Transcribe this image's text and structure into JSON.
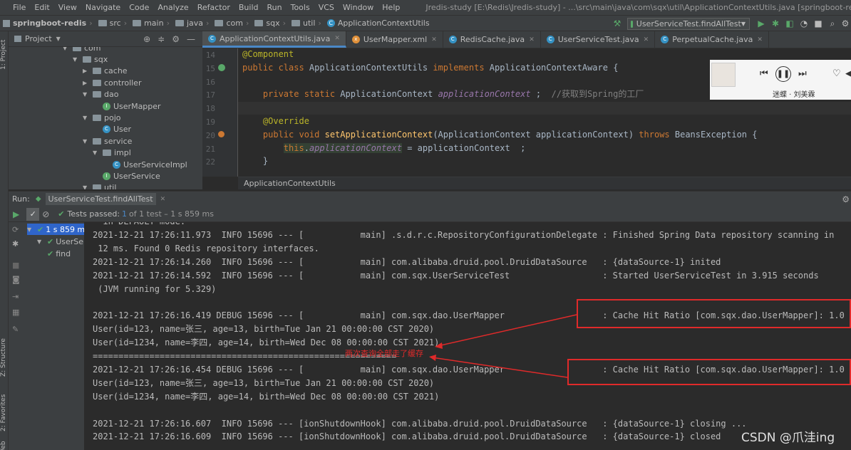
{
  "menu": {
    "items": [
      "File",
      "Edit",
      "View",
      "Navigate",
      "Code",
      "Analyze",
      "Refactor",
      "Build",
      "Run",
      "Tools",
      "VCS",
      "Window",
      "Help"
    ],
    "window_title": "Jredis-study [E:\\Redis\\Jredis-study] - ...\\src\\main\\java\\com\\sqx\\util\\ApplicationContextUtils.java [springboot-redis]"
  },
  "nav": {
    "crumbs": [
      "springboot-redis",
      "src",
      "main",
      "java",
      "com",
      "sqx",
      "util",
      "ApplicationContextUtils"
    ],
    "run_config": "UserServiceTest.findAllTest"
  },
  "stripe": {
    "project": "1: Project",
    "structure": "Z: Structure",
    "favorites": "2: Favorites",
    "web": "Web"
  },
  "project": {
    "title": "Project",
    "tree": [
      {
        "label": "com",
        "depth": 0,
        "kind": "folder",
        "open": true
      },
      {
        "label": "sqx",
        "depth": 1,
        "kind": "folder",
        "open": true
      },
      {
        "label": "cache",
        "depth": 2,
        "kind": "folder",
        "open": false
      },
      {
        "label": "controller",
        "depth": 2,
        "kind": "folder",
        "open": false
      },
      {
        "label": "dao",
        "depth": 2,
        "kind": "folder",
        "open": true
      },
      {
        "label": "UserMapper",
        "depth": 3,
        "kind": "interface"
      },
      {
        "label": "pojo",
        "depth": 2,
        "kind": "folder",
        "open": true
      },
      {
        "label": "User",
        "depth": 3,
        "kind": "class"
      },
      {
        "label": "service",
        "depth": 2,
        "kind": "folder",
        "open": true
      },
      {
        "label": "impl",
        "depth": 3,
        "kind": "folder",
        "open": true
      },
      {
        "label": "UserServiceImpl",
        "depth": 4,
        "kind": "class"
      },
      {
        "label": "UserService",
        "depth": 3,
        "kind": "interface"
      },
      {
        "label": "util",
        "depth": 2,
        "kind": "folder",
        "open": true
      }
    ]
  },
  "editor": {
    "tabs": [
      {
        "label": "ApplicationContextUtils.java",
        "active": true,
        "icon": "class-icon",
        "color": "#3592c4"
      },
      {
        "label": "UserMapper.xml",
        "active": false,
        "icon": "xml-icon",
        "color": "#e0913b"
      },
      {
        "label": "RedisCache.java",
        "active": false,
        "icon": "class-icon",
        "color": "#3592c4"
      },
      {
        "label": "UserServiceTest.java",
        "active": false,
        "icon": "test-class-icon",
        "color": "#3592c4"
      },
      {
        "label": "PerpetualCache.java",
        "active": false,
        "icon": "class-icon",
        "color": "#3592c4"
      }
    ],
    "line_numbers": [
      "14",
      "15",
      "16",
      "17",
      "18",
      "19",
      "20",
      "21",
      "22"
    ],
    "lines": [
      [
        {
          "t": "@Component",
          "c": "ann"
        }
      ],
      [
        {
          "t": "public class ",
          "c": "kw"
        },
        {
          "t": "ApplicationContextUtils ",
          "c": ""
        },
        {
          "t": "implements ",
          "c": "kw"
        },
        {
          "t": "ApplicationContextAware {",
          "c": ""
        }
      ],
      [],
      [
        {
          "t": "    private static ",
          "c": "kw"
        },
        {
          "t": "ApplicationContext ",
          "c": ""
        },
        {
          "t": "applicationContext",
          "c": "fld"
        },
        {
          "t": " ;  ",
          "c": ""
        },
        {
          "t": "//获取到Spring的工厂",
          "c": "cm"
        }
      ],
      [],
      [
        {
          "t": "    @Override",
          "c": "ann"
        }
      ],
      [
        {
          "t": "    public void ",
          "c": "kw"
        },
        {
          "t": "setApplicationContext",
          "c": "fn"
        },
        {
          "t": "(ApplicationContext applicationContext) ",
          "c": ""
        },
        {
          "t": "throws ",
          "c": "kw"
        },
        {
          "t": "BeansException {",
          "c": ""
        }
      ],
      [
        {
          "t": "        ",
          "c": ""
        },
        {
          "t": "this",
          "c": "kw"
        },
        {
          "t": ".",
          "c": ""
        },
        {
          "t": "applicationContext",
          "c": "fld"
        },
        {
          "t": " = applicationContext  ;",
          "c": ""
        }
      ],
      [
        {
          "t": "    }",
          "c": ""
        }
      ]
    ],
    "breadcrumb": "ApplicationContextUtils"
  },
  "music": {
    "song": "迷蝶 · 刘美霖"
  },
  "run": {
    "label": "Run:",
    "config": "UserServiceTest.findAllTest",
    "status_prefix": "Tests passed:",
    "status_count": "1",
    "status_rest": "of 1 test – 1 s 859 ms",
    "tree": [
      {
        "label": "1 s 859 ms",
        "depth": 0
      },
      {
        "label": "UserSe",
        "depth": 1
      },
      {
        "label": "find",
        "depth": 2
      }
    ],
    "console_lines": [
      "  in DEFAULT mode.",
      "2021-12-21 17:26:11.973  INFO 15696 --- [           main] .s.d.r.c.RepositoryConfigurationDelegate : Finished Spring Data repository scanning in",
      " 12 ms. Found 0 Redis repository interfaces.",
      "2021-12-21 17:26:14.260  INFO 15696 --- [           main] com.alibaba.druid.pool.DruidDataSource   : {dataSource-1} inited",
      "2021-12-21 17:26:14.592  INFO 15696 --- [           main] com.sqx.UserServiceTest                  : Started UserServiceTest in 3.915 seconds",
      " (JVM running for 5.329)",
      "",
      "2021-12-21 17:26:16.419 DEBUG 15696 --- [           main] com.sqx.dao.UserMapper                   : Cache Hit Ratio [com.sqx.dao.UserMapper]: 1.0",
      "User(id=123, name=张三, age=13, birth=Tue Jan 21 00:00:00 CST 2020)",
      "User(id=1234, name=李四, age=14, birth=Wed Dec 08 00:00:00 CST 2021)",
      "===========================================================",
      "2021-12-21 17:26:16.454 DEBUG 15696 --- [           main] com.sqx.dao.UserMapper                   : Cache Hit Ratio [com.sqx.dao.UserMapper]: 1.0",
      "User(id=123, name=张三, age=13, birth=Tue Jan 21 00:00:00 CST 2020)",
      "User(id=1234, name=李四, age=14, birth=Wed Dec 08 00:00:00 CST 2021)",
      "",
      "2021-12-21 17:26:16.607  INFO 15696 --- [ionShutdownHook] com.alibaba.druid.pool.DruidDataSource   : {dataSource-1} closing ...",
      "2021-12-21 17:26:16.609  INFO 15696 --- [ionShutdownHook] com.alibaba.druid.pool.DruidDataSource   : {dataSource-1} closed"
    ],
    "annotation": "两次查询全部走了缓存"
  },
  "watermark": "CSDN @爪洼ing",
  "colors": {
    "keyword": "#cc7832",
    "annotation": "#bbb529",
    "field": "#9876aa",
    "method": "#ffc66d",
    "comment": "#808080",
    "highlight": "#e02a2a",
    "pass": "#59a869"
  }
}
